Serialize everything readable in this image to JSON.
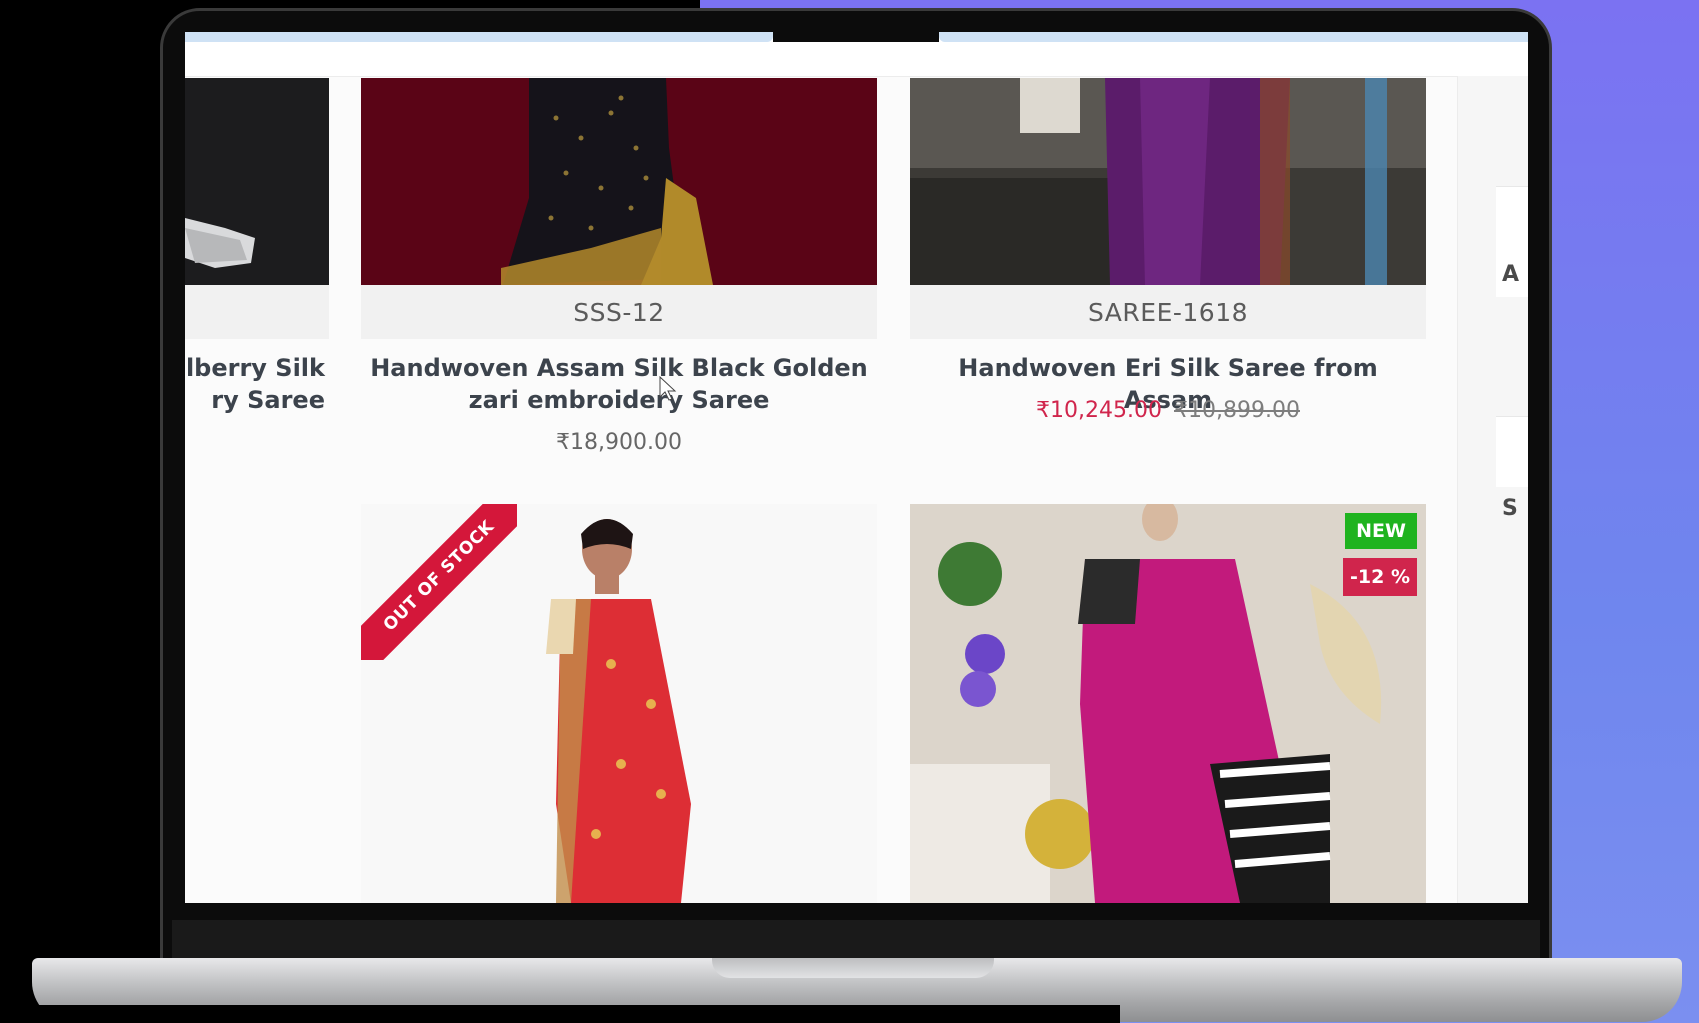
{
  "products_row1": [
    {
      "title_line1": "lberry Silk",
      "title_line2": "ry Saree"
    },
    {
      "sku": "SSS-12",
      "title_line1": "Handwoven Assam Silk Black Golden",
      "title_line2": "zari embroidery Saree",
      "price": "₹18,900.00"
    },
    {
      "sku": "SAREE-1618",
      "title": "Handwoven Eri Silk Saree from Assam",
      "sale_price": "₹10,245.00",
      "old_price": "₹10,899.00"
    }
  ],
  "products_row2": {
    "out_of_stock_label": "OUT OF STOCK",
    "new_badge": "NEW",
    "discount_badge": "-12 %"
  },
  "sidebar_letters": [
    "A",
    "S"
  ],
  "colors": {
    "sale": "#d0254c",
    "new_badge": "#1fb31f",
    "discount_badge": "#d0254c",
    "ribbon": "#d4173a"
  }
}
